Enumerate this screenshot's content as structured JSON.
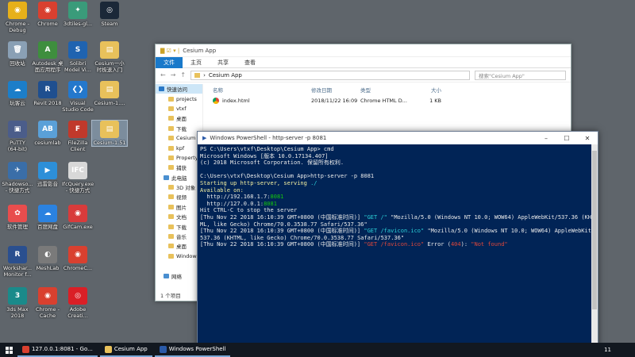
{
  "desktop": {
    "icons": [
      {
        "label": "Chrome -\nDebug",
        "color": "#e6b01a",
        "glyph": "◉"
      },
      {
        "label": "Chrome",
        "color": "#d9402f",
        "glyph": "◉"
      },
      {
        "label": "3dtiles-gl...",
        "color": "#3a9b7a",
        "glyph": "✦"
      },
      {
        "label": "Steam",
        "color": "#1b2838",
        "glyph": "◎"
      },
      {
        "label": "回收站",
        "color": "#8aa0b5",
        "glyph": "🗑"
      },
      {
        "label": "Autodesk 桌\n面应用程序",
        "color": "#3e8e3e",
        "glyph": "A"
      },
      {
        "label": "Solibri\nModel Vi...",
        "color": "#1f63b0",
        "glyph": "S"
      },
      {
        "label": "Cesium一小\n时极速入门",
        "color": "#e8c15b",
        "glyph": "▤"
      },
      {
        "label": "玩客云",
        "color": "#1c7ec9",
        "glyph": "☁"
      },
      {
        "label": "Revit 2018",
        "color": "#1f4f8f",
        "glyph": "R"
      },
      {
        "label": "Visual\nStudio Code",
        "color": "#2478cc",
        "glyph": "❮❯"
      },
      {
        "label": "Cesium-1....",
        "color": "#e8c15b",
        "glyph": "▤"
      },
      {
        "label": "PuTTY\n(64-bit)",
        "color": "#4b5d8a",
        "glyph": "▣"
      },
      {
        "label": "cesiumlab",
        "color": "#5aa0d8",
        "glyph": "AB"
      },
      {
        "label": "FileZilla\nClient",
        "color": "#c0392b",
        "glyph": "F"
      },
      {
        "label": "Cesium-1.51",
        "color": "#e8c15b",
        "glyph": "▤"
      },
      {
        "label": "Shadowso...\n- 快捷方式",
        "color": "#3a6ea8",
        "glyph": "✈"
      },
      {
        "label": "迅雷影音",
        "color": "#2d8fd8",
        "glyph": "▶"
      },
      {
        "label": "IfcQuery.exe\n- 快捷方式",
        "color": "#d8d8d8",
        "glyph": "IFC"
      },
      {
        "label": "",
        "color": "#000000",
        "glyph": ""
      },
      {
        "label": "软件管理",
        "color": "#e84d4d",
        "glyph": "✿"
      },
      {
        "label": "百度网盘",
        "color": "#2b82e0",
        "glyph": "☁"
      },
      {
        "label": "GifCam.exe",
        "color": "#d83b3b",
        "glyph": "◉"
      },
      {
        "label": "",
        "color": "#000000",
        "glyph": ""
      },
      {
        "label": "Workshar...\nMonitor f...",
        "color": "#2a4f8f",
        "glyph": "R"
      },
      {
        "label": "MeshLab",
        "color": "#7a7a7a",
        "glyph": "◐"
      },
      {
        "label": "ChromeC...",
        "color": "#d9402f",
        "glyph": "◉"
      },
      {
        "label": "",
        "color": "#000000",
        "glyph": ""
      },
      {
        "label": "3ds Max\n2018",
        "color": "#1a8a8a",
        "glyph": "3"
      },
      {
        "label": "Chrome -\nCache",
        "color": "#d9402f",
        "glyph": "◉"
      },
      {
        "label": "Adobe\nCreati...",
        "color": "#da1f26",
        "glyph": "◎"
      }
    ]
  },
  "explorer": {
    "title": "Cesium App",
    "ribbon_tabs": [
      "文件",
      "主页",
      "共享",
      "查看"
    ],
    "path": "Cesium App",
    "search_placeholder": "搜索\"Cesium App\"",
    "sidebar": [
      {
        "label": "快速访问",
        "kind": "top"
      },
      {
        "label": "projects",
        "kind": "sub"
      },
      {
        "label": "vtxf",
        "kind": "sub"
      },
      {
        "label": "桌面",
        "kind": "sub"
      },
      {
        "label": "下载",
        "kind": "sub"
      },
      {
        "label": "Cesium",
        "kind": "sub"
      },
      {
        "label": "kpf",
        "kind": "sub"
      },
      {
        "label": "Property",
        "kind": "sub"
      },
      {
        "label": "捕获",
        "kind": "sub"
      },
      {
        "label": "此电脑",
        "kind": "top2"
      },
      {
        "label": "3D 对象",
        "kind": "sub"
      },
      {
        "label": "视频",
        "kind": "sub"
      },
      {
        "label": "图片",
        "kind": "sub"
      },
      {
        "label": "文档",
        "kind": "sub"
      },
      {
        "label": "下载",
        "kind": "sub"
      },
      {
        "label": "音乐",
        "kind": "sub"
      },
      {
        "label": "桌面",
        "kind": "sub"
      },
      {
        "label": "Windows",
        "kind": "sub"
      },
      {
        "label": "",
        "kind": "sub"
      },
      {
        "label": "网络",
        "kind": "top2"
      }
    ],
    "columns": [
      "名称",
      "修改日期",
      "类型",
      "大小"
    ],
    "files": [
      {
        "name": "index.html",
        "modified": "2018/11/22 16:09",
        "type": "Chrome HTML D...",
        "size": "1 KB"
      }
    ],
    "status": "1 个项目"
  },
  "powershell": {
    "title": "Windows PowerShell - http-server -p 8081",
    "lines": [
      [
        {
          "t": "PS C:\\Users\\vtxf\\Desktop\\Cesium App> cmd",
          "c": ""
        }
      ],
      [
        {
          "t": "Microsoft Windows [版本 10.0.17134.407]",
          "c": ""
        }
      ],
      [
        {
          "t": "(c) 2018 Microsoft Corporation. 保留所有权利.",
          "c": ""
        }
      ],
      [
        {
          "t": " ",
          "c": ""
        }
      ],
      [
        {
          "t": "C:\\Users\\vtxf\\Desktop\\Cesium App>http-server -p 8081",
          "c": ""
        }
      ],
      [
        {
          "t": "Starting up http-server, serving ",
          "c": "y"
        },
        {
          "t": "./",
          "c": "cy"
        }
      ],
      [
        {
          "t": "Available on:",
          "c": "y"
        }
      ],
      [
        {
          "t": "  http://192.168.1.7:",
          "c": ""
        },
        {
          "t": "8081",
          "c": "g"
        }
      ],
      [
        {
          "t": "  http://127.0.0.1:",
          "c": ""
        },
        {
          "t": "8081",
          "c": "g"
        }
      ],
      [
        {
          "t": "Hit CTRL-C to stop the server",
          "c": ""
        }
      ],
      [
        {
          "t": "[Thu Nov 22 2018 16:10:39 GMT+0800 (中国标准时间)] ",
          "c": ""
        },
        {
          "t": "\"GET /\"",
          "c": "cy"
        },
        {
          "t": " \"Mozilla/5.0 (Windows NT 10.0; WOW64) AppleWebKit/537.36 (KHT",
          "c": ""
        }
      ],
      [
        {
          "t": "ML, like Gecko) Chrome/70.0.3538.77 Safari/537.36\"",
          "c": ""
        }
      ],
      [
        {
          "t": "[Thu Nov 22 2018 16:10:39 GMT+0800 (中国标准时间)] ",
          "c": ""
        },
        {
          "t": "\"GET /favicon.ico\"",
          "c": "cy"
        },
        {
          "t": " \"Mozilla/5.0 (Windows NT 10.0; WOW64) AppleWebKit/",
          "c": ""
        }
      ],
      [
        {
          "t": "537.36 (KHTML, like Gecko) Chrome/70.0.3538.77 Safari/537.36\"",
          "c": ""
        }
      ],
      [
        {
          "t": "[Thu Nov 22 2018 16:10:39 GMT+0800 (中国标准时间)] ",
          "c": ""
        },
        {
          "t": "\"GET /favicon.ico\"",
          "c": "r"
        },
        {
          "t": " Error (",
          "c": ""
        },
        {
          "t": "404",
          "c": "r"
        },
        {
          "t": "): ",
          "c": ""
        },
        {
          "t": "\"Not found\"",
          "c": "r"
        }
      ]
    ]
  },
  "taskbar": {
    "items": [
      {
        "label": "127.0.0.1:8081 - Go...",
        "color": "#d9402f"
      },
      {
        "label": "Cesium App",
        "color": "#e8c15b"
      },
      {
        "label": "Windows PowerShell",
        "color": "#2a5aa8"
      }
    ],
    "clock": "11"
  }
}
